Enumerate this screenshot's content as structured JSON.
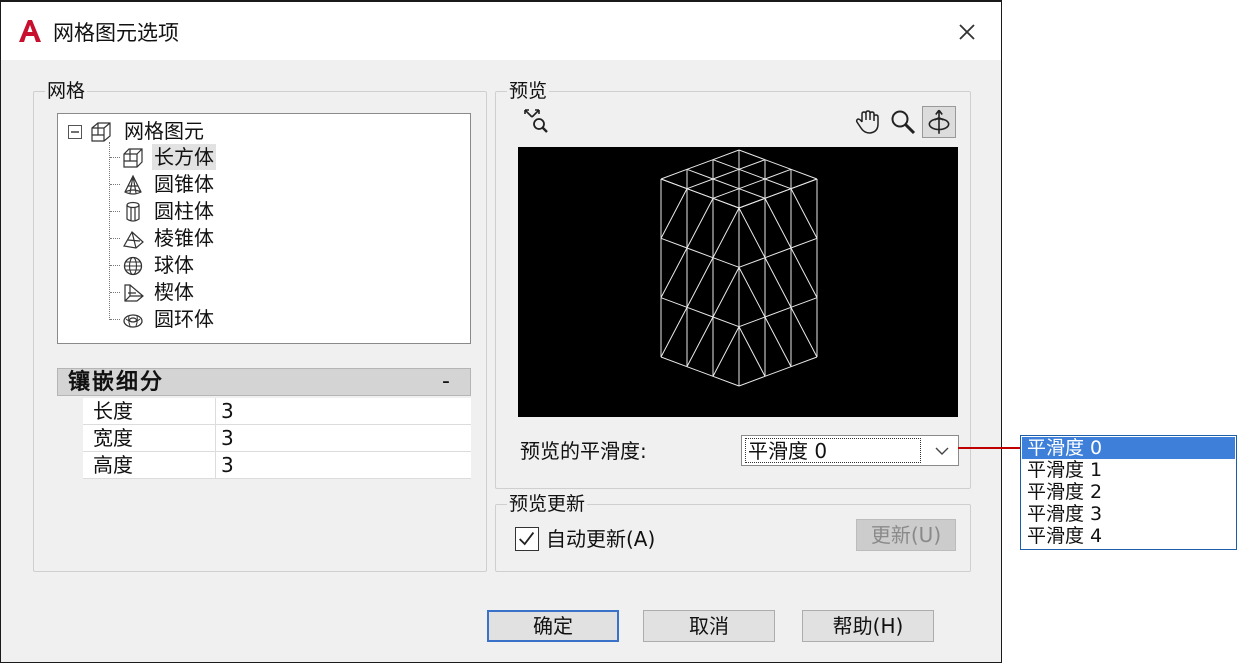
{
  "window": {
    "title": "网格图元选项"
  },
  "mesh_group": {
    "legend": "网格",
    "tree": {
      "root": "网格图元",
      "items": [
        "长方体",
        "圆锥体",
        "圆柱体",
        "棱锥体",
        "球体",
        "楔体",
        "圆环体"
      ]
    },
    "tessellation": {
      "header": "镶嵌细分",
      "collapse": "-",
      "rows": [
        {
          "label": "长度",
          "value": "3"
        },
        {
          "label": "宽度",
          "value": "3"
        },
        {
          "label": "高度",
          "value": "3"
        }
      ]
    }
  },
  "preview_group": {
    "legend": "预览",
    "tools": [
      "extents-zoom-icon",
      "pan-hand-icon",
      "zoom-icon",
      "orbit-icon"
    ],
    "smoothness_label": "预览的平滑度:",
    "smoothness_value": "平滑度 0",
    "smoothness_options": [
      "平滑度 0",
      "平滑度 1",
      "平滑度 2",
      "平滑度 3",
      "平滑度 4"
    ]
  },
  "update_group": {
    "legend": "预览更新",
    "auto_update_label": "自动更新(A)",
    "auto_update_checked": true,
    "update_button": "更新(U)"
  },
  "buttons": {
    "ok": "确定",
    "cancel": "取消",
    "help": "帮助(H)"
  },
  "colors": {
    "accent": "#3d7fd9",
    "logo": "#c8102e",
    "connector": "#c00000"
  }
}
